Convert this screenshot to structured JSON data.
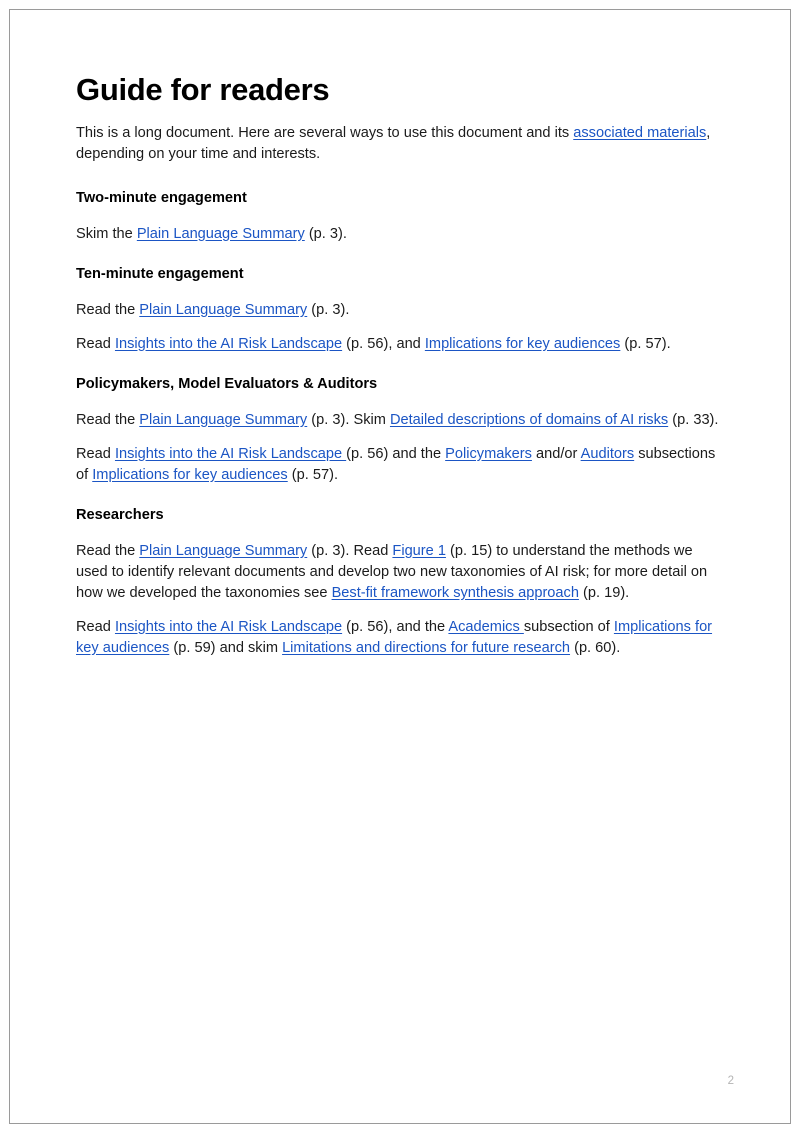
{
  "page": {
    "title": "Guide for readers",
    "page_number": "2",
    "link_color": "#1b55c4",
    "text_color": "#1b1b1b",
    "page_number_color": "#b4b4b4",
    "border_color": "#9a9a9a"
  },
  "intro": {
    "runs": [
      {
        "type": "text",
        "text": "This is a long document. Here are several ways to use this document and its "
      },
      {
        "type": "link",
        "text": "associated materials"
      },
      {
        "type": "text",
        "text": ", depending on your time and interests."
      }
    ]
  },
  "sections": [
    {
      "heading": "Two-minute engagement",
      "paragraphs": [
        {
          "runs": [
            {
              "type": "text",
              "text": "Skim the "
            },
            {
              "type": "link",
              "text": "Plain Language Summary"
            },
            {
              "type": "text",
              "text": " (p. 3)."
            }
          ]
        }
      ]
    },
    {
      "heading": "Ten-minute engagement",
      "paragraphs": [
        {
          "runs": [
            {
              "type": "text",
              "text": "Read the "
            },
            {
              "type": "link",
              "text": "Plain Language Summary"
            },
            {
              "type": "text",
              "text": " (p. 3)."
            }
          ]
        },
        {
          "runs": [
            {
              "type": "text",
              "text": "Read "
            },
            {
              "type": "link",
              "text": "Insights into the AI Risk Landscape"
            },
            {
              "type": "text",
              "text": " (p. 56), and "
            },
            {
              "type": "link",
              "text": "Implications for key audiences"
            },
            {
              "type": "text",
              "text": " (p. 57)."
            }
          ]
        }
      ]
    },
    {
      "heading": "Policymakers, Model Evaluators & Auditors",
      "paragraphs": [
        {
          "runs": [
            {
              "type": "text",
              "text": "Read the "
            },
            {
              "type": "link",
              "text": "Plain Language Summary"
            },
            {
              "type": "text",
              "text": " (p. 3). Skim "
            },
            {
              "type": "link",
              "text": "Detailed descriptions of domains of AI risks"
            },
            {
              "type": "text",
              "text": " (p. 33)."
            }
          ]
        },
        {
          "runs": [
            {
              "type": "text",
              "text": "Read "
            },
            {
              "type": "link",
              "text": "Insights into the AI Risk Landscape "
            },
            {
              "type": "text",
              "text": "(p. 56) and the "
            },
            {
              "type": "link",
              "text": "Policymakers"
            },
            {
              "type": "text",
              "text": " and/or "
            },
            {
              "type": "link",
              "text": "Auditors"
            },
            {
              "type": "text",
              "text": " subsections of "
            },
            {
              "type": "link",
              "text": "Implications for key audiences"
            },
            {
              "type": "text",
              "text": " (p. 57)."
            }
          ]
        }
      ]
    },
    {
      "heading": "Researchers",
      "paragraphs": [
        {
          "runs": [
            {
              "type": "text",
              "text": "Read the "
            },
            {
              "type": "link",
              "text": "Plain Language Summary"
            },
            {
              "type": "text",
              "text": " (p. 3). Read "
            },
            {
              "type": "link",
              "text": "Figure 1"
            },
            {
              "type": "text",
              "text": " (p. 15) to understand the methods we used to identify relevant documents and develop two new taxonomies of AI risk; for more detail on how we developed the taxonomies see "
            },
            {
              "type": "link",
              "text": "Best-fit framework synthesis approach"
            },
            {
              "type": "text",
              "text": " (p. 19)."
            }
          ]
        },
        {
          "runs": [
            {
              "type": "text",
              "text": "Read "
            },
            {
              "type": "link",
              "text": "Insights into the AI Risk Landscape"
            },
            {
              "type": "text",
              "text": " (p. 56), and the "
            },
            {
              "type": "link",
              "text": "Academics "
            },
            {
              "type": "text",
              "text": "subsection of "
            },
            {
              "type": "link",
              "text": "Implications for key audiences"
            },
            {
              "type": "text",
              "text": " (p. 59) and skim "
            },
            {
              "type": "link",
              "text": "Limitations and directions for future research"
            },
            {
              "type": "text",
              "text": " (p. 60)."
            }
          ]
        }
      ]
    }
  ]
}
